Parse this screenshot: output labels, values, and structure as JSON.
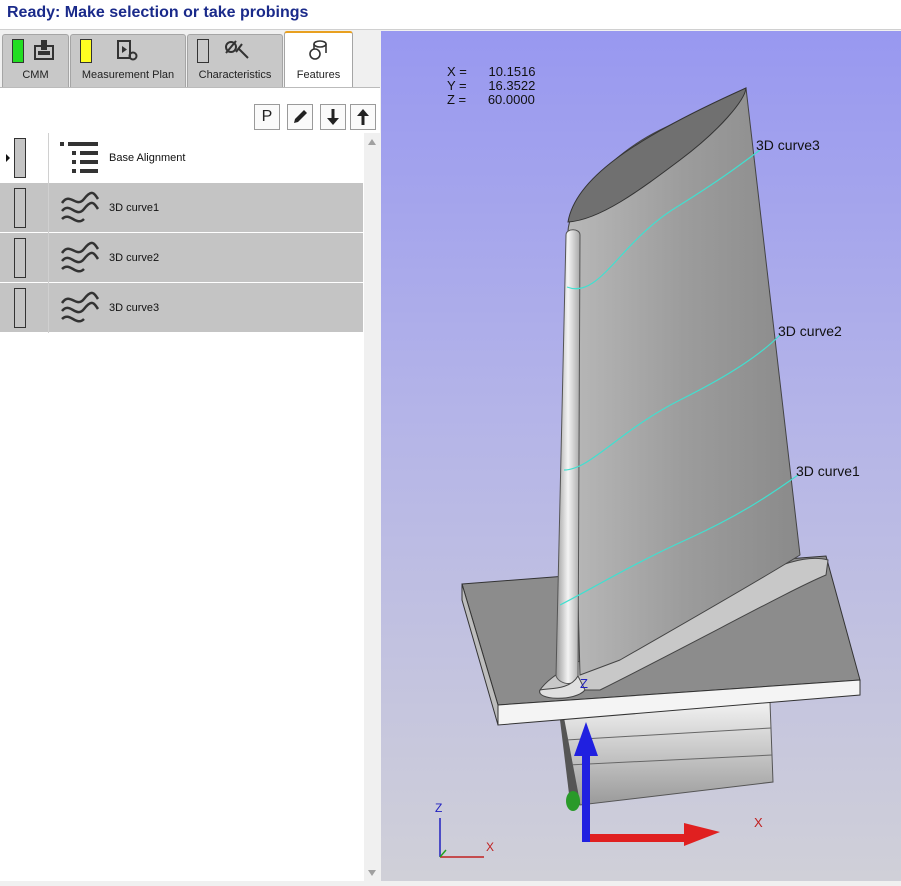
{
  "status": {
    "text": "Ready: Make selection or take probings"
  },
  "tabs": [
    {
      "label": "CMM",
      "indicator_color": "#22dd22"
    },
    {
      "label": "Measurement Plan",
      "indicator_color": "#ffff22"
    },
    {
      "label": "Characteristics",
      "indicator_color": "#c8c8c8"
    },
    {
      "label": "Features"
    }
  ],
  "toolbar": {
    "p_label": "P",
    "edit_icon": "pencil-icon",
    "down_icon": "arrow-down-icon",
    "up_icon": "arrow-up-icon"
  },
  "features": [
    {
      "label": "Base Alignment",
      "icon": "list-icon"
    },
    {
      "label": "3D curve1",
      "icon": "curve-icon"
    },
    {
      "label": "3D curve2",
      "icon": "curve-icon"
    },
    {
      "label": "3D curve3",
      "icon": "curve-icon"
    }
  ],
  "viewport": {
    "coords": {
      "x_label": "X =",
      "x_value": "10.1516",
      "y_label": "Y =",
      "y_value": "16.3522",
      "z_label": "Z =",
      "z_value": "60.0000"
    },
    "curve_labels": [
      "3D curve3",
      "3D curve2",
      "3D curve1"
    ],
    "axis_labels": {
      "x": "X",
      "z": "Z",
      "mini_x": "X",
      "mini_z": "Z"
    }
  },
  "colors": {
    "status_text": "#1a2a8a",
    "active_tab_accent": "#e8a020",
    "selected_row": "#c4c4c4",
    "curve_color": "#40e0d0"
  }
}
